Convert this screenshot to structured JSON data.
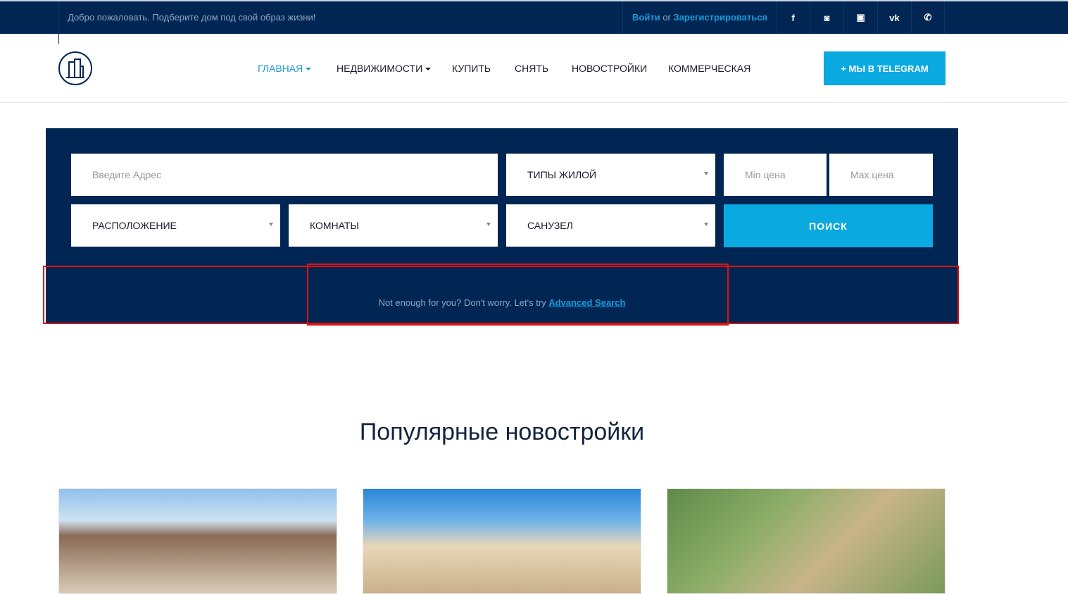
{
  "topbar": {
    "welcome": "Добро пожаловать. Подберите дом под свой образ жизни!",
    "login": "Войти",
    "or": "or",
    "register": "Зарегистрироваться",
    "social": [
      {
        "icon": "facebook-icon",
        "glyph": "f"
      },
      {
        "icon": "instagram-icon",
        "glyph": "◙"
      },
      {
        "icon": "youtube-icon",
        "glyph": "▣"
      },
      {
        "icon": "vk-icon",
        "glyph": "vk"
      },
      {
        "icon": "whatsapp-icon",
        "glyph": "✆"
      }
    ]
  },
  "nav": {
    "items": [
      "ГЛАВНАЯ",
      "НЕДВИЖИМОСТИ",
      "КУПИТЬ",
      "СНЯТЬ",
      "НОВОСТРОЙКИ",
      "КОММЕРЧЕСКАЯ"
    ],
    "telegram": "+ МЫ В TELEGRAM"
  },
  "search": {
    "address_placeholder": "Введите Адрес",
    "type": "ТИПЫ ЖИЛОЙ",
    "min_placeholder": "Min цена",
    "max_placeholder": "Max цена",
    "location": "РАСПОЛОЖЕНИЕ",
    "rooms": "КОМНАТЫ",
    "bathroom": "САНУЗЕЛ",
    "button": "ПОИСК",
    "advanced_text": "Not enough for you? Don't worry. Let's try",
    "advanced_link": "Advanced Search"
  },
  "section_title": "Популярные новостройки",
  "colors": {
    "navy": "#022654",
    "accent": "#0aa9e0",
    "annotation": "#e01010"
  }
}
